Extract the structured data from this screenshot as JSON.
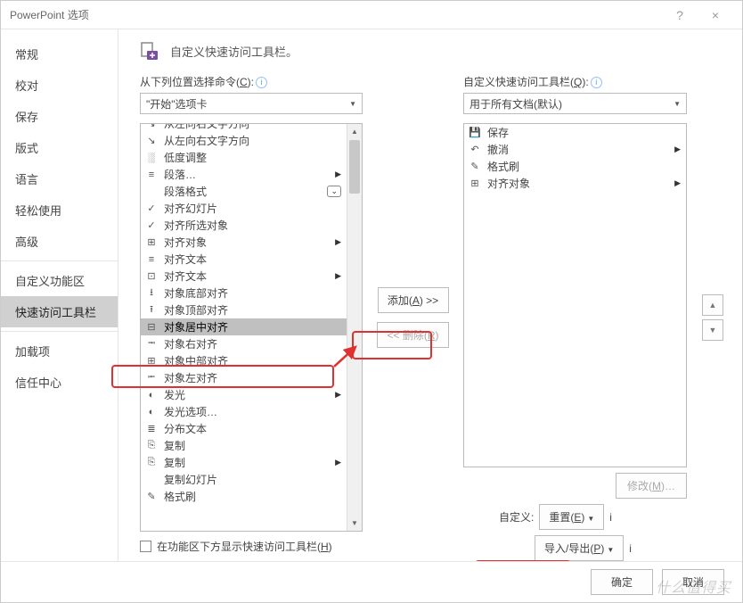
{
  "window": {
    "title": "PowerPoint 选项",
    "help": "?",
    "close": "×"
  },
  "sidebar": {
    "items": [
      "常规",
      "校对",
      "保存",
      "版式",
      "语言",
      "轻松使用",
      "高级"
    ],
    "items2": [
      "自定义功能区",
      "快速访问工具栏"
    ],
    "items3": [
      "加载项",
      "信任中心"
    ],
    "selected": "快速访问工具栏"
  },
  "header": {
    "text": "自定义快速访问工具栏。"
  },
  "left": {
    "label_pre": "从下列位置选择命令(",
    "label_u": "C",
    "label_post": "):",
    "combo": "\"开始\"选项卡",
    "items": [
      {
        "icon": "↘",
        "text": "从左向右文字方向",
        "sub": false,
        "cut": true
      },
      {
        "icon": "↘",
        "text": "从左向右文字方向",
        "sub": false
      },
      {
        "icon": "░",
        "text": "低度调整",
        "sub": false
      },
      {
        "icon": "≡",
        "text": "段落…",
        "sub": true
      },
      {
        "icon": "",
        "text": "段落格式",
        "sub": false,
        "dlg": true
      },
      {
        "icon": "✓",
        "text": "对齐幻灯片",
        "sub": false
      },
      {
        "icon": "✓",
        "text": "对齐所选对象",
        "sub": false
      },
      {
        "icon": "⊞",
        "text": "对齐对象",
        "sub": true
      },
      {
        "icon": "≡",
        "text": "对齐文本",
        "sub": false
      },
      {
        "icon": "⊡",
        "text": "对齐文本",
        "sub": true
      },
      {
        "icon": "⭳",
        "text": "对象底部对齐",
        "sub": false
      },
      {
        "icon": "⭱",
        "text": "对象顶部对齐",
        "sub": false
      },
      {
        "icon": "⊟",
        "text": "对象居中对齐",
        "sub": false,
        "selected": true
      },
      {
        "icon": "⭲",
        "text": "对象右对齐",
        "sub": false
      },
      {
        "icon": "⊞",
        "text": "对象中部对齐",
        "sub": false
      },
      {
        "icon": "⭰",
        "text": "对象左对齐",
        "sub": false
      },
      {
        "icon": "◐",
        "text": "发光",
        "sub": true
      },
      {
        "icon": "◐",
        "text": "发光选项…",
        "sub": false
      },
      {
        "icon": "≣",
        "text": "分布文本",
        "sub": false
      },
      {
        "icon": "⎘",
        "text": "复制",
        "sub": false
      },
      {
        "icon": "⎘",
        "text": "复制",
        "sub": true
      },
      {
        "icon": "",
        "text": "复制幻灯片",
        "sub": false
      },
      {
        "icon": "✎",
        "text": "格式刷",
        "sub": false,
        "cut2": true
      }
    ],
    "show_below_cb": "在功能区下方显示快速访问工具栏(",
    "show_below_u": "H",
    "show_below_post": ")"
  },
  "mid": {
    "add_pre": "添加(",
    "add_u": "A",
    "add_post": ") >>",
    "remove_pre": "<< 删除(",
    "remove_u": "R",
    "remove_post": ")"
  },
  "right": {
    "label_pre": "自定义快速访问工具栏(",
    "label_u": "Q",
    "label_post": "):",
    "combo": "用于所有文档(默认)",
    "items": [
      {
        "icon": "💾",
        "text": "保存"
      },
      {
        "icon": "↶",
        "text": "撤消",
        "sub": true
      },
      {
        "icon": "✎",
        "text": "格式刷"
      },
      {
        "icon": "⊞",
        "text": "对齐对象",
        "sub": true
      }
    ],
    "modify_pre": "修改(",
    "modify_u": "M",
    "modify_post": ")…",
    "customize_label": "自定义:",
    "reset_pre": "重置(",
    "reset_u": "E",
    "reset_post": ")",
    "import_pre": "导入/导出(",
    "import_u": "P",
    "import_post": ")"
  },
  "updown": {
    "up": "▲",
    "down": "▼"
  },
  "footer": {
    "ok": "确定",
    "cancel": "取消"
  },
  "watermark": "什么值得买"
}
